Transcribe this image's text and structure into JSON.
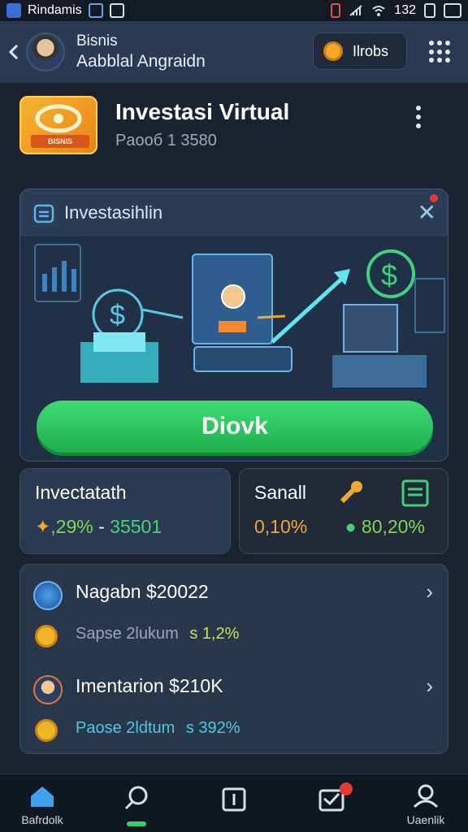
{
  "status_bar": {
    "app_name": "Rindamis",
    "time": "132"
  },
  "header": {
    "name_line1": "Bisnis",
    "name_line2": "Aabblal Angraidn",
    "button_label": "Ilrobs",
    "icons": [
      "back-icon",
      "coin-icon",
      "grid-icon"
    ]
  },
  "app": {
    "title": "Investasi Virtual",
    "subtitle": "Paooб 1 3580",
    "logo_tag": "BISNIS"
  },
  "promo": {
    "title": "Investasihlin",
    "button_label": "Diovk"
  },
  "stats": [
    {
      "title": "Invectatath",
      "value_a": ",29%",
      "sep": " - ",
      "value_b": "35501",
      "value_a_color": "#7bd957",
      "value_b_color": "#49d37b"
    },
    {
      "title": "Sanall",
      "value_a": "0,10%",
      "value_b": "80,20%",
      "value_a_color": "#f2a634",
      "value_b_color": "#7bd957"
    }
  ],
  "list": [
    {
      "name": "Nagabn $20022",
      "sub_label": "Sapse 2lukum",
      "pct_prefix": "s",
      "pct": "1,2%",
      "pct_color": "#c8e35a"
    },
    {
      "name": "Imentarion $210K",
      "sub_label": "Paose 2ldtum",
      "pct_prefix": "s",
      "pct": "392%",
      "pct_color": "#4fc6e8"
    }
  ],
  "nav": [
    {
      "label": "Bafrdolk",
      "icon": "home-icon"
    },
    {
      "label": "",
      "icon": "search-icon"
    },
    {
      "label": "",
      "icon": "clipboard-icon"
    },
    {
      "label": "",
      "icon": "inbox-icon"
    },
    {
      "label": "Uaenlik",
      "icon": "profile-icon"
    }
  ]
}
